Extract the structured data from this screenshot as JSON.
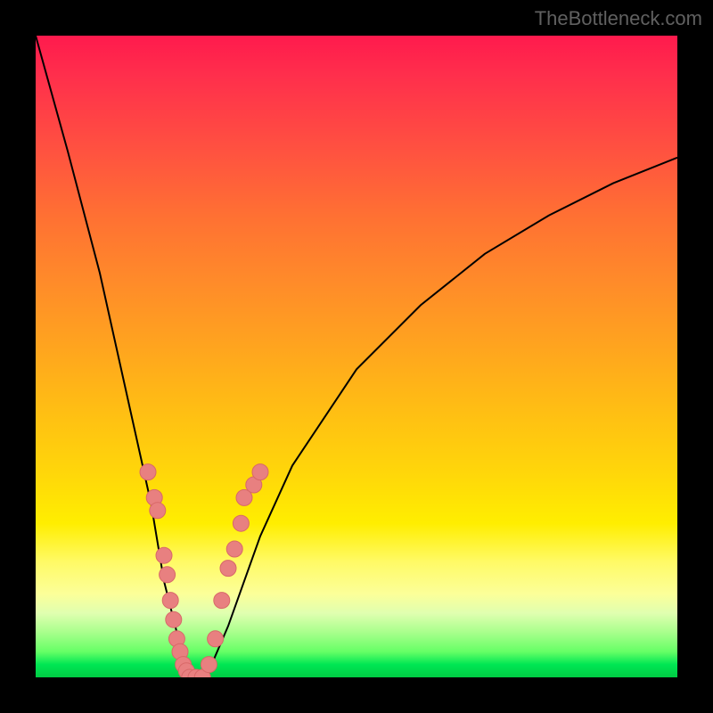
{
  "watermark": "TheBottleneck.com",
  "chart_data": {
    "type": "line",
    "title": "",
    "xlabel": "",
    "ylabel": "",
    "xlim": [
      0,
      100
    ],
    "ylim": [
      0,
      100
    ],
    "curve": {
      "x": [
        0,
        5,
        10,
        14,
        18,
        20,
        22,
        24,
        25,
        27,
        30,
        35,
        40,
        50,
        60,
        70,
        80,
        90,
        100
      ],
      "y": [
        100,
        82,
        63,
        45,
        27,
        15,
        7,
        1,
        0,
        1,
        8,
        22,
        33,
        48,
        58,
        66,
        72,
        77,
        81
      ]
    },
    "scatter_points": {
      "x": [
        17.5,
        18.5,
        19,
        20,
        20.5,
        21,
        21.5,
        22,
        22.5,
        23,
        23.5,
        24,
        25,
        26,
        27,
        28,
        29,
        30,
        31,
        32,
        32.5,
        34,
        35
      ],
      "y": [
        32,
        28,
        26,
        19,
        16,
        12,
        9,
        6,
        4,
        2,
        1,
        0,
        0,
        0,
        2,
        6,
        12,
        17,
        20,
        24,
        28,
        30,
        32
      ]
    }
  }
}
